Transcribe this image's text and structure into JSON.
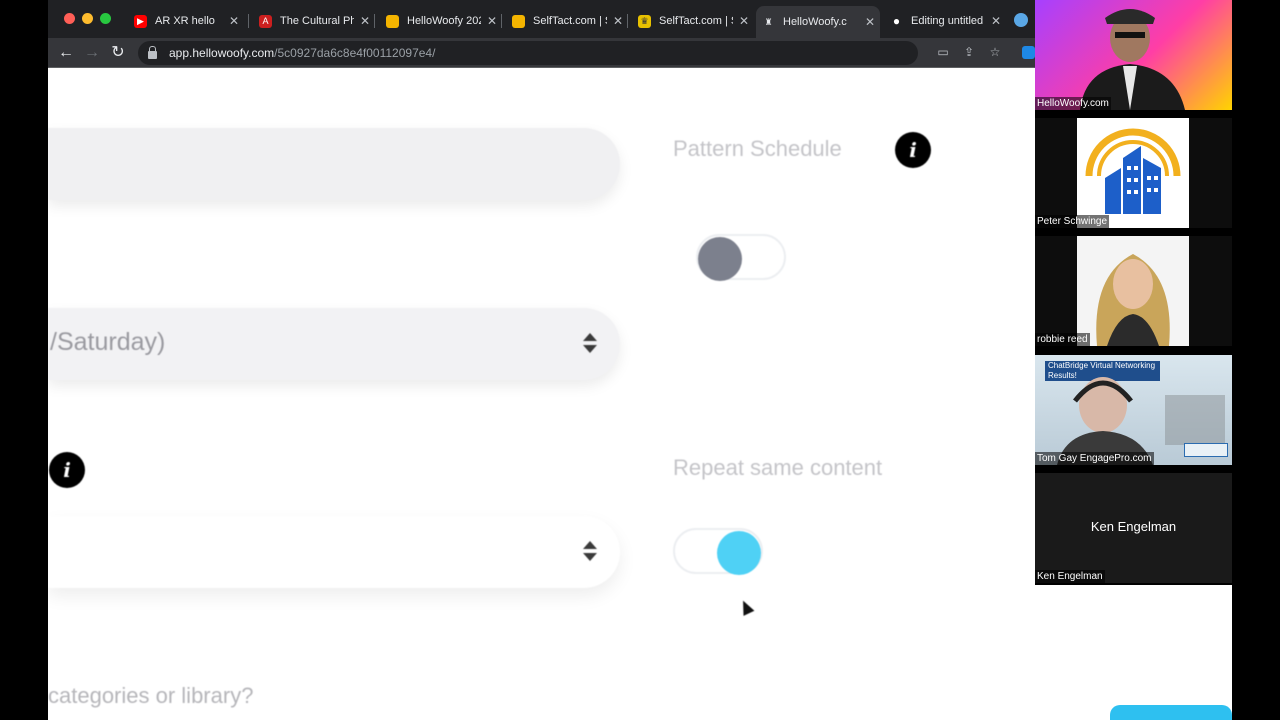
{
  "browser": {
    "tabs": [
      {
        "title": "AR XR hello",
        "fav_color": "#ff0000",
        "fav_glyph": "▶"
      },
      {
        "title": "The Cultural Ph",
        "fav_color": "#cc1f1f",
        "fav_glyph": "A"
      },
      {
        "title": "HelloWoofy 202",
        "fav_color": "#f4b400",
        "fav_glyph": ""
      },
      {
        "title": "SelfTact.com | S",
        "fav_color": "#f4b400",
        "fav_glyph": ""
      },
      {
        "title": "SelfTact.com | S",
        "fav_color": "#e8c100",
        "fav_glyph": "♛"
      },
      {
        "title": "HelloWoofy.c",
        "fav_color": "#5f6368",
        "fav_glyph": "♜",
        "active": true
      },
      {
        "title": "Editing untitled",
        "fav_color": "#ffffff",
        "fav_glyph": "●"
      }
    ],
    "url_host": "app.hellowoofy.com",
    "url_path": "/5c0927da6c8e4f00112097e4/"
  },
  "page": {
    "pattern_schedule_label": "Pattern Schedule",
    "pattern_schedule_enabled": false,
    "day_select_value": "/Saturday)",
    "repeat_label": "Repeat same content",
    "repeat_enabled": true,
    "bottom_question": "categories or library?",
    "info_glyph": "i"
  },
  "colors": {
    "toggle_on": "#4fd1f5",
    "toggle_off": "#7c808d"
  },
  "participants": [
    {
      "name": "HelloWoofy.com"
    },
    {
      "name": "Peter Schwinge"
    },
    {
      "name": "robbie reed"
    },
    {
      "name": "Tom Gay EngagePro.com",
      "overlay": "ChatBridge Virtual Networking Results!"
    },
    {
      "name": "Ken Engelman",
      "center_label": "Ken Engelman"
    }
  ]
}
